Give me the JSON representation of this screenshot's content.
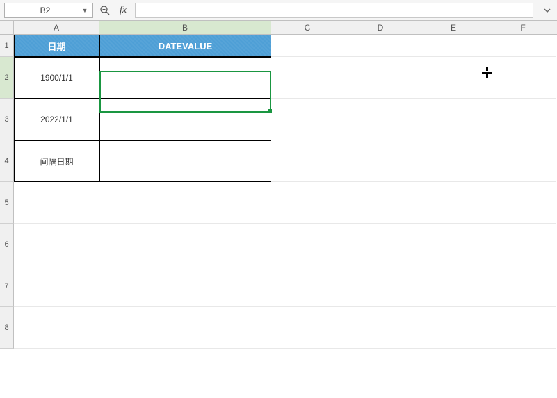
{
  "toolbar": {
    "namebox": "B2",
    "fx_label": "fx",
    "formula_value": ""
  },
  "columns": [
    "A",
    "B",
    "C",
    "D",
    "E",
    "F"
  ],
  "row_numbers": [
    "1",
    "2",
    "3",
    "4",
    "5",
    "6",
    "7",
    "8"
  ],
  "table": {
    "headers": {
      "a": "日期",
      "b": "DATEVALUE"
    },
    "rows": [
      {
        "a": "1900/1/1",
        "b": ""
      },
      {
        "a": "2022/1/1",
        "b": ""
      },
      {
        "a": "间隔日期",
        "b": ""
      }
    ]
  },
  "selected_cell": "B2"
}
